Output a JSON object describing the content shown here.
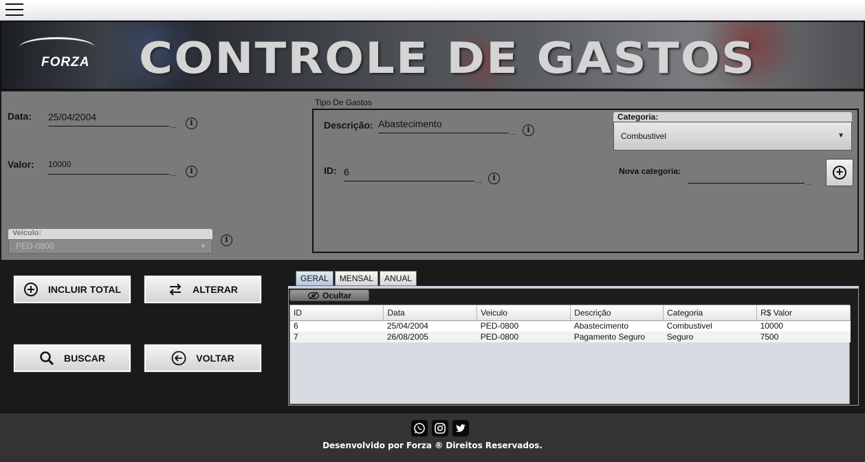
{
  "header": {
    "menu_icon": "hamburger-icon"
  },
  "banner": {
    "brand": "FORZA",
    "title": "CONTROLE DE GASTOS"
  },
  "form": {
    "data_label": "Data:",
    "data_value": "25/04/2004",
    "valor_label": "Valor:",
    "valor_value": "10000",
    "veiculo_label": "Veiculo:",
    "veiculo_value": "PED-0800",
    "info_glyph": "i",
    "ellipsis": "..."
  },
  "tipo_gastos": {
    "title": "Tipo De Gastos",
    "descricao_label": "Descrição:",
    "descricao_value": "Abastecimento",
    "id_label": "ID:",
    "id_value": "6",
    "categoria_label": "Categoria:",
    "categoria_value": "Combustivel",
    "nova_categoria_label": "Nova categoria:",
    "nova_categoria_value": ""
  },
  "buttons": {
    "incluir": "INCLUIR TOTAL",
    "alterar": "ALTERAR",
    "buscar": "BUSCAR",
    "voltar": "VOLTAR"
  },
  "tabs": [
    "GERAL",
    "MENSAL",
    "ANUAL"
  ],
  "active_tab": "GERAL",
  "hide_button": "Ocultar",
  "table": {
    "columns": [
      "ID",
      "Data",
      "Veiculo",
      "Descrição",
      "Categoria",
      "R$ Valor"
    ],
    "rows": [
      [
        "6",
        "25/04/2004",
        "PED-0800",
        "Abastecimento",
        "Combustivel",
        "10000"
      ],
      [
        "7",
        "26/08/2005",
        "PED-0800",
        "Pagamento Seguro",
        "Seguro",
        "7500"
      ]
    ]
  },
  "footer": {
    "social_icons": [
      "whatsapp-icon",
      "instagram-icon",
      "twitter-icon"
    ],
    "text": "Desenvolvido por Forza ® Direitos Reservados."
  }
}
